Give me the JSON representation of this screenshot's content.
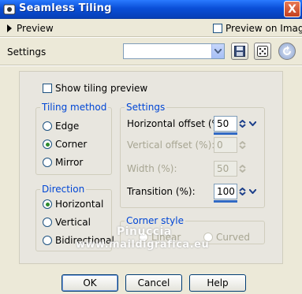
{
  "window": {
    "title": "Seamless Tiling",
    "close_glyph": "X",
    "icon": "app-icon"
  },
  "preview_bar": {
    "preview_label": "Preview",
    "preview_on_image_label": "Preview on Image"
  },
  "settings_bar": {
    "label": "Settings",
    "preset_value": "",
    "save_icon": "floppy-disk-icon",
    "random_icon": "dice-icon",
    "reset_icon": "reset-arrow-icon"
  },
  "main": {
    "show_tiling_preview_label": "Show tiling preview",
    "tiling_method": {
      "title": "Tiling method",
      "options": [
        "Edge",
        "Corner",
        "Mirror"
      ],
      "selected": "Corner"
    },
    "direction": {
      "title": "Direction",
      "options": [
        "Horizontal",
        "Vertical",
        "Bidirectional"
      ],
      "selected": "Horizontal"
    },
    "settings": {
      "title": "Settings",
      "horizontal_offset": {
        "label": "Horizontal offset (%):",
        "value": "50",
        "enabled": true
      },
      "vertical_offset": {
        "label": "Vertical offset (%):",
        "value": "0",
        "enabled": false
      },
      "width": {
        "label": "Width (%):",
        "value": "50",
        "enabled": false
      },
      "transition": {
        "label": "Transition (%):",
        "value": "100",
        "enabled": true
      }
    },
    "corner_style": {
      "title": "Corner style",
      "options": [
        "Linear",
        "Curved"
      ]
    }
  },
  "watermark": {
    "line1": "Pinuccia",
    "line2": "www.maildigrafica.eu"
  },
  "footer": {
    "ok_label": "OK",
    "cancel_label": "Cancel",
    "help_label": "Help"
  },
  "colors": {
    "titlebar": "#0a4fd8",
    "group_title": "#0046d5",
    "selected_dot": "#2e8b2e",
    "spin_bar": "#316ac5"
  }
}
